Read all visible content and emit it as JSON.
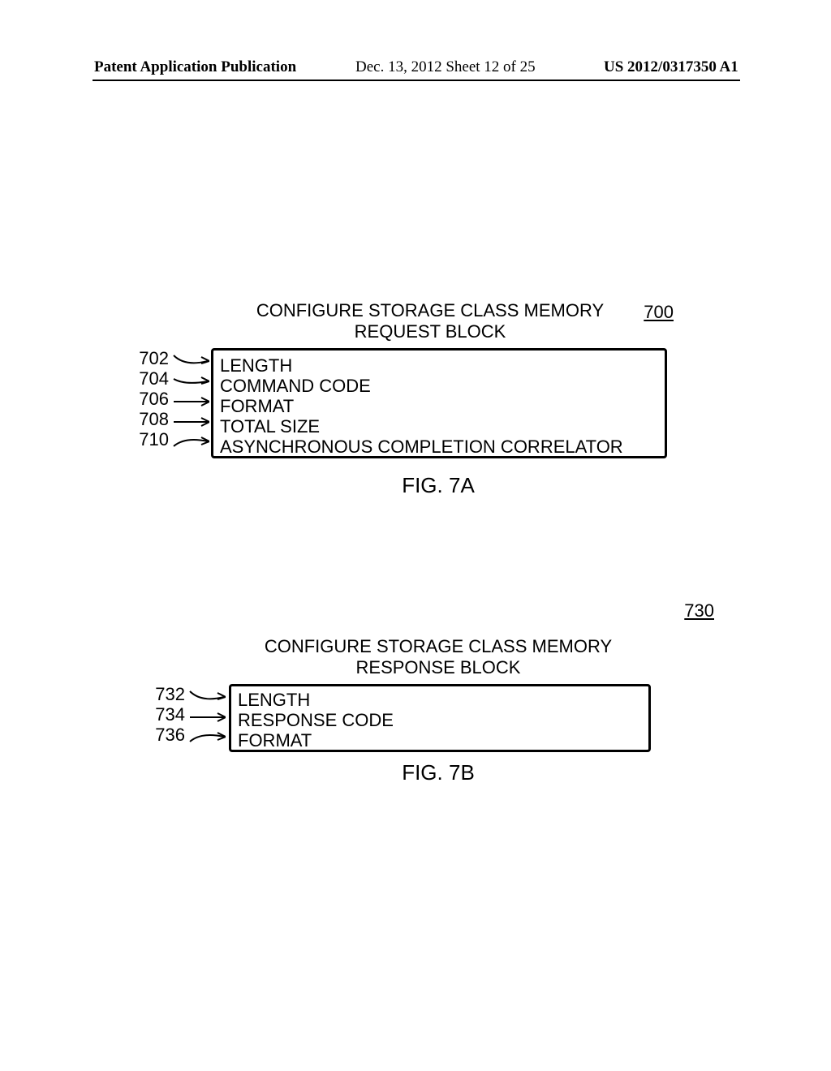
{
  "header": {
    "left": "Patent Application Publication",
    "center": "Dec. 13, 2012  Sheet 12 of 25",
    "right": "US 2012/0317350 A1"
  },
  "figA": {
    "title_line1": "CONFIGURE STORAGE CLASS MEMORY",
    "title_line2": "REQUEST BLOCK",
    "ref": "700",
    "rows": [
      {
        "num": "702",
        "text": "LENGTH"
      },
      {
        "num": "704",
        "text": "COMMAND CODE"
      },
      {
        "num": "706",
        "text": "FORMAT"
      },
      {
        "num": "708",
        "text": "TOTAL SIZE"
      },
      {
        "num": "710",
        "text": "ASYNCHRONOUS COMPLETION CORRELATOR"
      }
    ],
    "caption": "FIG. 7A"
  },
  "figB": {
    "title_line1": "CONFIGURE STORAGE CLASS MEMORY",
    "title_line2": "RESPONSE BLOCK",
    "ref": "730",
    "rows": [
      {
        "num": "732",
        "text": "LENGTH"
      },
      {
        "num": "734",
        "text": "RESPONSE CODE"
      },
      {
        "num": "736",
        "text": "FORMAT"
      }
    ],
    "caption": "FIG. 7B"
  }
}
